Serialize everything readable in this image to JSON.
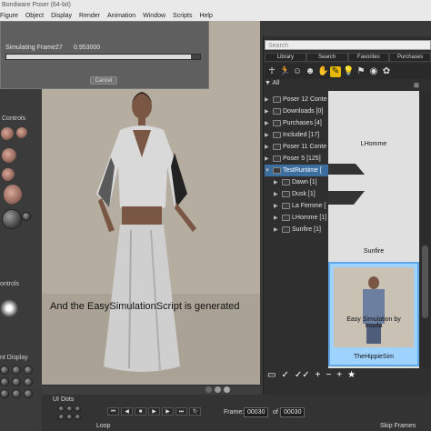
{
  "window": {
    "title": "Bondware Poser (64-bit)"
  },
  "menu": [
    "Figure",
    "Object",
    "Display",
    "Render",
    "Animation",
    "Window",
    "Scripts",
    "Help"
  ],
  "sim_dialog": {
    "label": "Simulating Frame:",
    "frame": "27",
    "value": "0.953000",
    "progress": 0.953,
    "cancel": "Cancel"
  },
  "left_panel": {
    "controls_title": "Controls",
    "controls2": "ontrols",
    "display": "nt Display"
  },
  "caption": "And the EasySimulationScript is generated",
  "library": {
    "search_placeholder": "Search",
    "tabs": [
      "Library",
      "Search",
      "Favorites",
      "Purchases"
    ],
    "all_label": "All",
    "tree": [
      {
        "label": "Poser 12 Conte",
        "depth": 0,
        "selected": false
      },
      {
        "label": "Downloads [0]",
        "depth": 0,
        "selected": false
      },
      {
        "label": "Purchases [4]",
        "depth": 0,
        "selected": false
      },
      {
        "label": "Included [17]",
        "depth": 0,
        "selected": false
      },
      {
        "label": "Poser 11 Conte",
        "depth": 0,
        "selected": false
      },
      {
        "label": "Poser 5 [125]",
        "depth": 0,
        "selected": false
      },
      {
        "label": "TestRuntime [",
        "depth": 0,
        "selected": true
      },
      {
        "label": "Dawn [1]",
        "depth": 1,
        "selected": false
      },
      {
        "label": "Dusk [1]",
        "depth": 1,
        "selected": false
      },
      {
        "label": "La Femme [",
        "depth": 1,
        "selected": false
      },
      {
        "label": "LHomme [1]",
        "depth": 1,
        "selected": false
      },
      {
        "label": "Sunfire [1]",
        "depth": 1,
        "selected": false
      }
    ],
    "thumb_labels": [
      "LHomme",
      "Sunfire",
      "TheHippieSim"
    ],
    "thumb_overlay": "Easy Simulation by Irouila"
  },
  "bottom": {
    "ui_dots": "UI Dots",
    "loop": "Loop",
    "skip_frames": "Skip Frames",
    "frame_label": "Frame:",
    "frame_current": "00030",
    "frame_total": "00030"
  },
  "colors": {
    "selected": "#3c6ea0",
    "active_icon": "#e6b800",
    "thumb_selected": "#9fd3ff"
  }
}
